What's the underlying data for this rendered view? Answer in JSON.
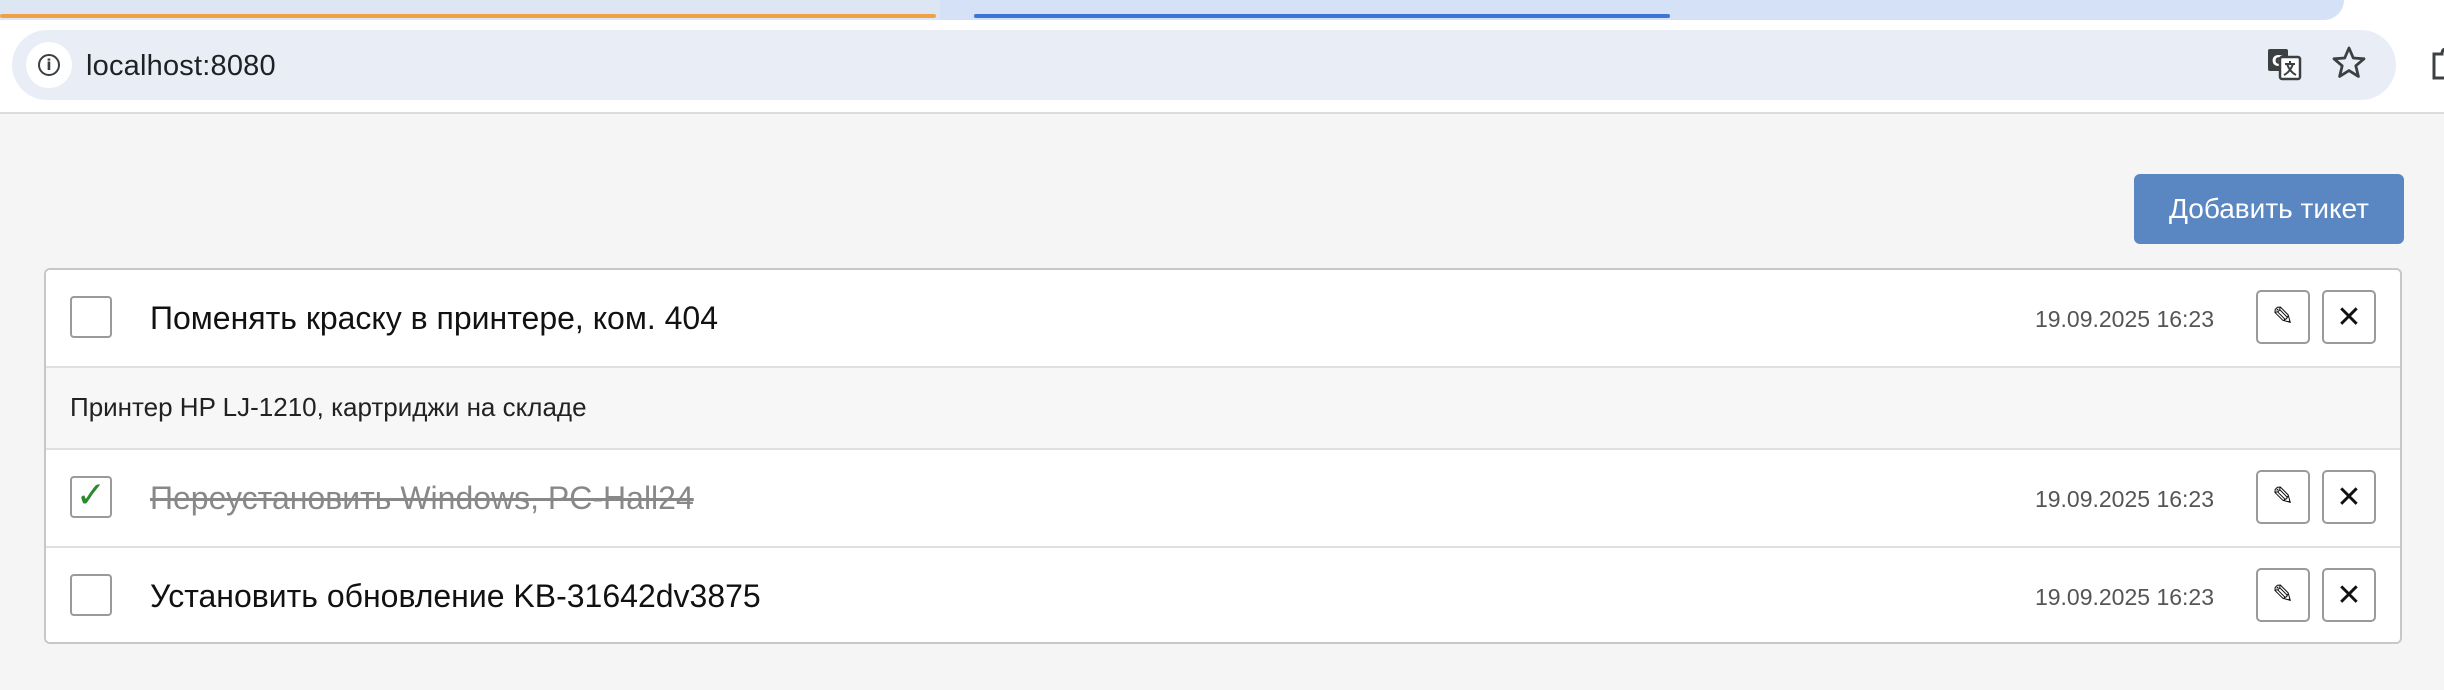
{
  "browser": {
    "url": "localhost:8080"
  },
  "page": {
    "add_button_label": "Добавить тикет"
  },
  "tickets": [
    {
      "title": "Поменять краску в принтере, ком. 404",
      "date": "19.09.2025 16:23",
      "done": false,
      "description": "Принтер HP LJ-1210, картриджи на складе"
    },
    {
      "title": "Переустановить Windows, PC-Hall24",
      "date": "19.09.2025 16:23",
      "done": true
    },
    {
      "title": "Установить обновление KB-31642dv3875",
      "date": "19.09.2025 16:23",
      "done": false
    }
  ],
  "icons": {
    "edit": "pencil-icon",
    "delete": "close-icon",
    "check": "checkmark-icon"
  },
  "colors": {
    "accent": "#5a86c2",
    "check": "#2b8a2b"
  }
}
